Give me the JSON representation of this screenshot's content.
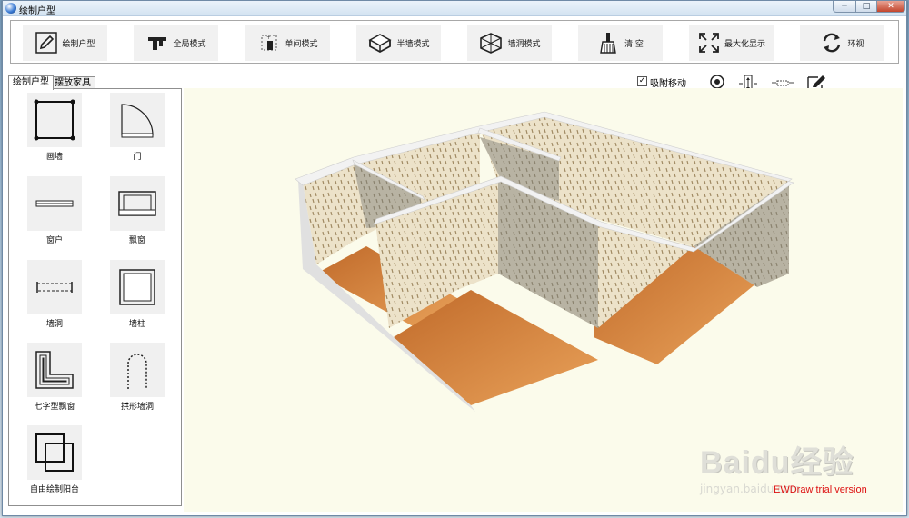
{
  "window": {
    "title": "绘制户型",
    "min": "─",
    "max": "□",
    "close": "✕"
  },
  "toolbar": [
    {
      "label": "绘制户型",
      "icon": "pencil-icon"
    },
    {
      "label": "全局模式",
      "icon": "global-mode-icon"
    },
    {
      "label": "单间模式",
      "icon": "single-room-icon"
    },
    {
      "label": "半墙模式",
      "icon": "half-wall-icon"
    },
    {
      "label": "墙洞模式",
      "icon": "wall-hole-icon"
    },
    {
      "label": "清 空",
      "icon": "broom-icon"
    },
    {
      "label": "最大化显示",
      "icon": "maximize-icon"
    },
    {
      "label": "环视",
      "icon": "rotate-icon"
    }
  ],
  "tabs": {
    "draw": "绘制户型",
    "furniture": "摆放家具"
  },
  "palette": [
    {
      "label": "画墙",
      "icon": "wall-square-icon"
    },
    {
      "label": "门",
      "icon": "door-icon"
    },
    {
      "label": "窗户",
      "icon": "window-icon"
    },
    {
      "label": "飘窗",
      "icon": "bay-window-icon"
    },
    {
      "label": "墙洞",
      "icon": "wall-opening-icon"
    },
    {
      "label": "墙柱",
      "icon": "pillar-icon"
    },
    {
      "label": "七字型飘窗",
      "icon": "l-bay-window-icon"
    },
    {
      "label": "拱形墙洞",
      "icon": "arch-opening-icon"
    },
    {
      "label": "自由绘制阳台",
      "icon": "balcony-icon"
    }
  ],
  "viewport_tools": {
    "snap_label": "吸附移动",
    "snap_checked": "✓"
  },
  "watermark": "EWDraw trial version",
  "baidu": {
    "logo": "Baidu经验",
    "sub": "jingyan.baidu.com"
  },
  "colors": {
    "floor": "#d9873a",
    "wall_top": "#f2f2f2",
    "viewport_bg": "#fbfbeb"
  }
}
